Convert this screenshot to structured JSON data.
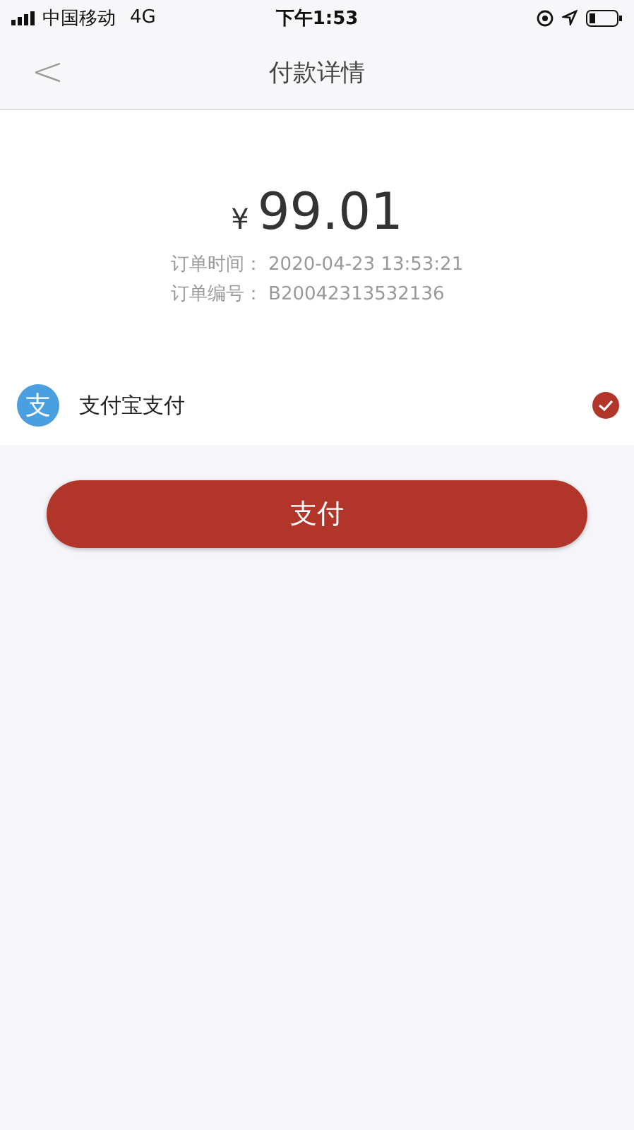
{
  "status_bar": {
    "carrier": "中国移动",
    "network": "4G",
    "time": "下午1:53"
  },
  "nav": {
    "back": "<",
    "title": "付款详情"
  },
  "order": {
    "currency": "¥",
    "amount": "99.01",
    "time_label": "订单时间：",
    "time": "2020-04-23 13:53:21",
    "number_label": "订单编号：",
    "number": "B20042313532136"
  },
  "payment_methods": [
    {
      "icon_glyph": "支",
      "label": "支付宝支付",
      "selected": true
    }
  ],
  "pay_button": "支付"
}
